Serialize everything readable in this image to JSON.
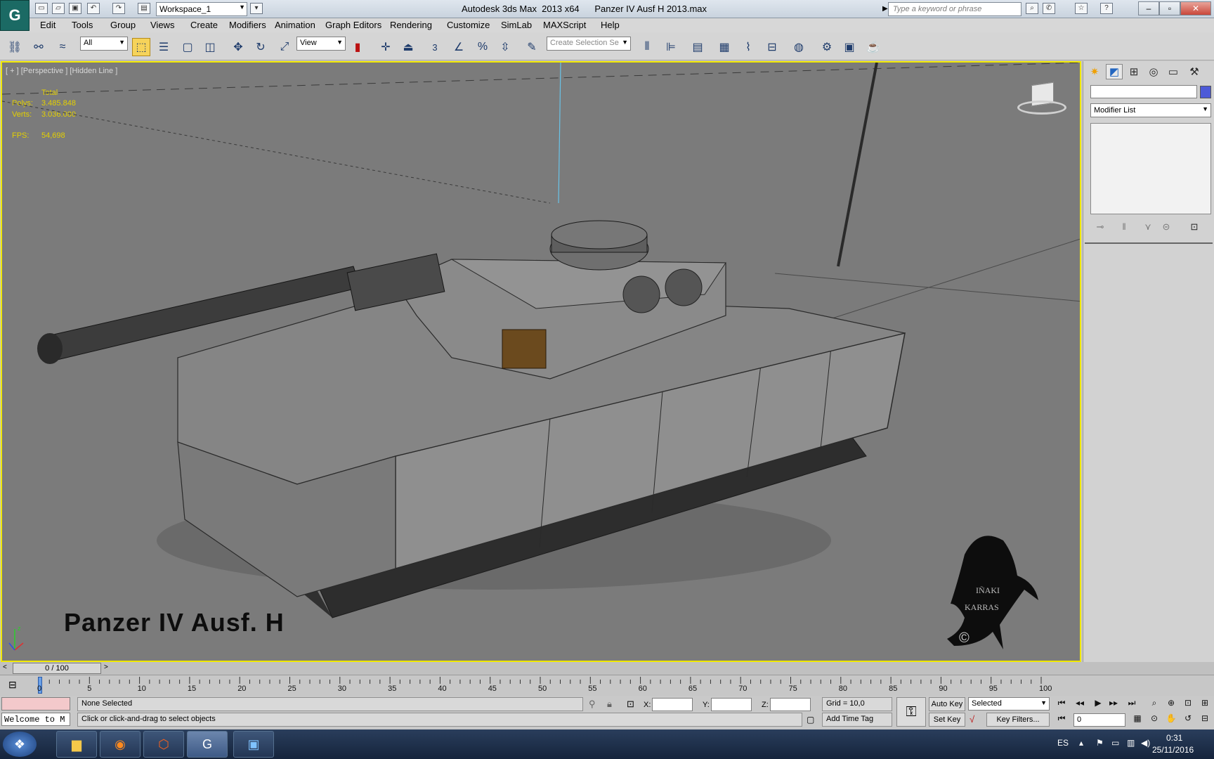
{
  "titlebar": {
    "workspace": "Workspace_1",
    "app_title": "Autodesk 3ds Max  2013 x64",
    "file_name": "Panzer IV Ausf H 2013.max",
    "search_placeholder": "Type a keyword or phrase"
  },
  "menu": [
    "Edit",
    "Tools",
    "Group",
    "Views",
    "Create",
    "Modifiers",
    "Animation",
    "Graph Editors",
    "Rendering",
    "Customize",
    "SimLab",
    "MAXScript",
    "Help"
  ],
  "toolbar": {
    "selection_filter": "All",
    "ref_coord": "View",
    "snap_value": "3",
    "named_selection_placeholder": "Create Selection Se"
  },
  "viewport": {
    "label": "[ + ] [Perspective ] [Hidden Line ]",
    "stats": {
      "total_label": "Total",
      "polys_label": "Polys:",
      "polys_value": "3.485.848",
      "verts_label": "Verts:",
      "verts_value": "3.036.080",
      "fps_label": "FPS:",
      "fps_value": "54,698"
    },
    "caption": "Panzer IV Ausf. H",
    "logo_text_1": "IÑAKI",
    "logo_text_2": "KARRAS",
    "logo_mark": "©"
  },
  "command_panel": {
    "modifier_list": "Modifier List",
    "swatch_color": "#4d5ad7"
  },
  "timeline": {
    "slider_label": "0 / 100",
    "ticks": [
      "0",
      "5",
      "10",
      "15",
      "20",
      "25",
      "30",
      "35",
      "40",
      "45",
      "50",
      "55",
      "60",
      "65",
      "70",
      "75",
      "80",
      "85",
      "90",
      "95",
      "100"
    ]
  },
  "status": {
    "maxscript_listener": "Welcome to M",
    "selection_status": "None Selected",
    "prompt": "Click or click-and-drag to select objects",
    "x_label": "X:",
    "y_label": "Y:",
    "z_label": "Z:",
    "grid": "Grid = 10,0",
    "add_time_tag": "Add Time Tag",
    "auto_key": "Auto Key",
    "set_key": "Set Key",
    "key_mode": "Selected",
    "key_filters": "Key Filters...",
    "frame": "0"
  },
  "taskbar": {
    "lang": "ES",
    "time": "0:31",
    "date": "25/11/2016"
  }
}
